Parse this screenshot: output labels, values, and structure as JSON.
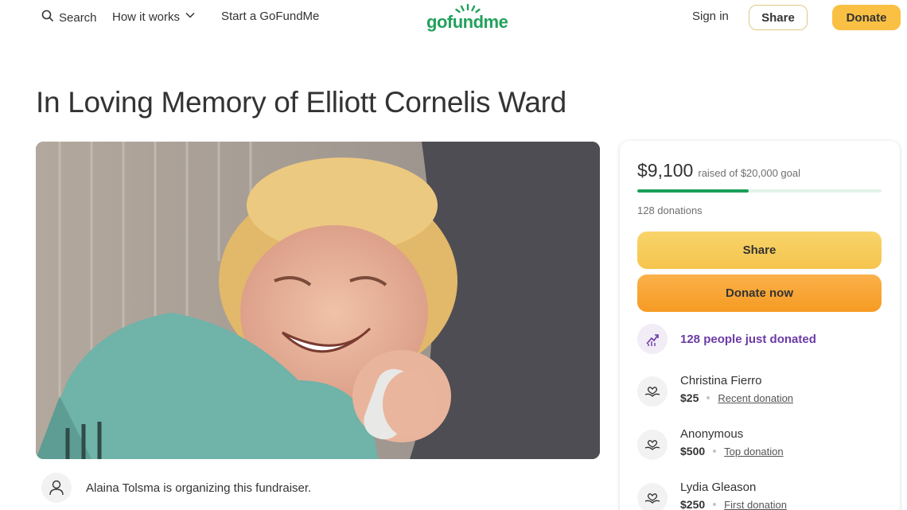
{
  "header": {
    "search_label": "Search",
    "how_it_works_label": "How it works",
    "start_label": "Start a GoFundMe",
    "logo_text": "gofundme",
    "signin_label": "Sign in",
    "share_label": "Share",
    "donate_label": "Donate"
  },
  "campaign": {
    "title": "In Loving Memory of Elliott Cornelis Ward",
    "organizer_text": "Alaina Tolsma is organizing this fundraiser."
  },
  "card": {
    "raised_amount": "$9,100",
    "raised_goal_text": "raised of $20,000 goal",
    "progress_fraction": 0.455,
    "donation_count_text": "128 donations",
    "share_label": "Share",
    "donate_label": "Donate now",
    "activity_text": "128 people just donated",
    "donors": [
      {
        "name": "Christina Fierro",
        "amount": "$25",
        "type": "Recent donation"
      },
      {
        "name": "Anonymous",
        "amount": "$500",
        "type": "Top donation"
      },
      {
        "name": "Lydia Gleason",
        "amount": "$250",
        "type": "First donation"
      }
    ]
  },
  "colors": {
    "brand_green": "#23a15c",
    "donate_orange": "#f59b23",
    "share_yellow": "#f5c44d",
    "activity_purple": "#6c3aa6"
  },
  "icons": {
    "search": "search-icon",
    "chevron": "chevron-down-icon",
    "organizer": "user-icon",
    "activity": "trending-up-icon",
    "donor": "heart-hand-icon"
  }
}
